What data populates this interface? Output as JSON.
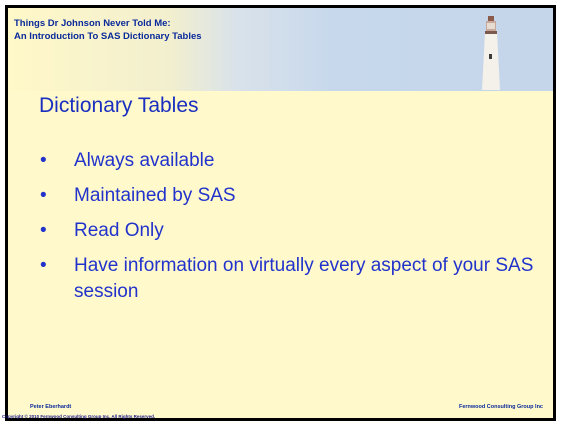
{
  "header": {
    "title_line1": "Things Dr Johnson Never Told Me:",
    "title_line2": "An Introduction To SAS Dictionary Tables",
    "image_icon": "lighthouse-icon"
  },
  "slide": {
    "title": "Dictionary Tables",
    "bullet_glyph": "•",
    "bullets": [
      "Always available",
      "Maintained by SAS",
      "Read Only",
      "Have information on virtually every aspect of your SAS session"
    ]
  },
  "footer": {
    "presenter": "Peter Eberhardt",
    "company": "Fernwood Consulting Group Inc",
    "copyright": "Copyright © 2010 Fernwood Consulting Group Inc. All Rights Reserved."
  },
  "colors": {
    "background": "#fff9cc",
    "title": "#1a2fc0",
    "bullet_text": "#2233cc",
    "header_text": "#0a2a9a"
  }
}
